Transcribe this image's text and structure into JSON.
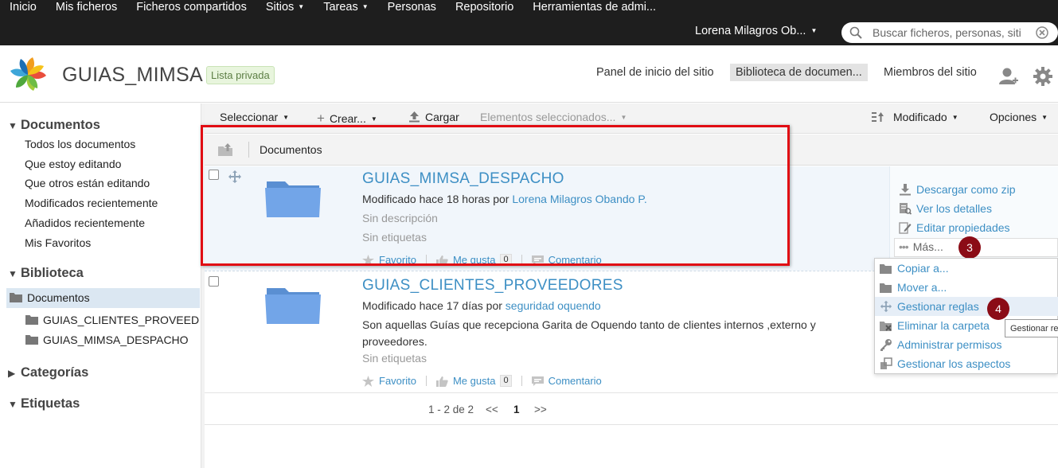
{
  "topnav": {
    "items": [
      {
        "label": "Inicio"
      },
      {
        "label": "Mis ficheros"
      },
      {
        "label": "Ficheros compartidos"
      },
      {
        "label": "Sitios",
        "caret": true
      },
      {
        "label": "Tareas",
        "caret": true
      },
      {
        "label": "Personas"
      },
      {
        "label": "Repositorio"
      },
      {
        "label": "Herramientas de admi..."
      }
    ],
    "user": "Lorena Milagros Ob...",
    "search_placeholder": "Buscar ficheros, personas, siti"
  },
  "site": {
    "title": "GUIAS_MIMSA",
    "privacy": "Lista privada",
    "nav": {
      "dashboard": "Panel de inicio del sitio",
      "library": "Biblioteca de documen...",
      "members": "Miembros del sitio"
    }
  },
  "sidebar": {
    "documents_heading": "Documentos",
    "filters": [
      "Todos los documentos",
      "Que estoy editando",
      "Que otros están editando",
      "Modificados recientemente",
      "Añadidos recientemente",
      "Mis Favoritos"
    ],
    "library_heading": "Biblioteca",
    "tree_root": "Documentos",
    "tree_children": [
      "GUIAS_CLIENTES_PROVEED",
      "GUIAS_MIMSA_DESPACHO"
    ],
    "categories_heading": "Categorías",
    "tags_heading": "Etiquetas"
  },
  "toolbar": {
    "select": "Seleccionar",
    "create": "Crear...",
    "upload": "Cargar",
    "selected": "Elementos seleccionados...",
    "sort": "Modificado",
    "options": "Opciones"
  },
  "breadcrumb": "Documentos",
  "items": [
    {
      "title": "GUIAS_MIMSA_DESPACHO",
      "modified_prefix": "Modificado hace 18 horas por",
      "modified_by": "Lorena Milagros Obando P.",
      "description": "Sin descripción",
      "tags": "Sin etiquetas",
      "favorite": "Favorito",
      "like": "Me gusta",
      "like_count": "0",
      "comment": "Comentario"
    },
    {
      "title": "GUIAS_CLIENTES_PROVEEDORES",
      "modified_prefix": "Modificado hace 17 días por",
      "modified_by": "seguridad oquendo",
      "description": "Son aquellas Guías que recepciona Garita de Oquendo tanto de clientes internos ,externo y proveedores.",
      "tags": "Sin etiquetas",
      "favorite": "Favorito",
      "like": "Me gusta",
      "like_count": "0",
      "comment": "Comentario"
    }
  ],
  "actions": {
    "download_zip": "Descargar como zip",
    "details": "Ver los detalles",
    "edit_props": "Editar propiedades",
    "more": "Más..."
  },
  "more_menu": {
    "copy": "Copiar a...",
    "move": "Mover a...",
    "rules": "Gestionar reglas",
    "delete": "Eliminar la carpeta",
    "permissions": "Administrar permisos",
    "aspects": "Gestionar los aspectos"
  },
  "tooltip": "Gestionar reglas",
  "steps": {
    "step3": "3",
    "step4": "4"
  },
  "pagination": {
    "range": "1 - 2 de 2",
    "prev": "<<",
    "current": "1",
    "next": ">>"
  },
  "colors": {
    "link": "#3d8fc4",
    "highlight": "#e10c13",
    "step_marker": "#8b0c16",
    "topbar": "#1e1e1e"
  }
}
